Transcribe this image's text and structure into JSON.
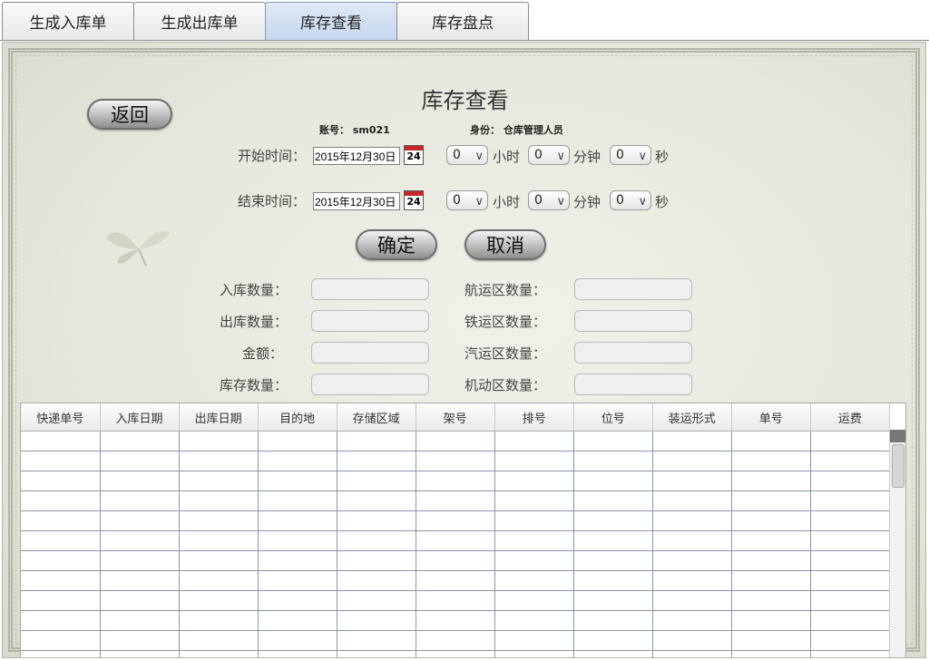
{
  "tabs": [
    {
      "label": "生成入库单",
      "active": false
    },
    {
      "label": "生成出库单",
      "active": false
    },
    {
      "label": "库存查看",
      "active": true
    },
    {
      "label": "库存盘点",
      "active": false
    }
  ],
  "back_label": "返回",
  "page_title": "库存查看",
  "account": "账号： sm021",
  "role": "身份： 仓库管理人员",
  "start": {
    "label": "开始时间：",
    "date": "2015年12月30日",
    "calendar_day": "24",
    "hour": "0",
    "minute": "0",
    "second": "0"
  },
  "end": {
    "label": "结束时间：",
    "date": "2015年12月30日",
    "calendar_day": "24",
    "hour": "0",
    "minute": "0",
    "second": "0"
  },
  "units": {
    "hour": "小时",
    "minute": "分钟",
    "second": "秒"
  },
  "buttons": {
    "confirm": "确定",
    "cancel": "取消"
  },
  "stats": {
    "in_count": "入库数量：",
    "out_count": "出库数量：",
    "amount": "金额：",
    "stock_count": "库存数量：",
    "ship_zone": "航运区数量：",
    "rail_zone": "铁运区数量：",
    "truck_zone": "汽运区数量：",
    "flex_zone": "机动区数量："
  },
  "table": {
    "columns": [
      "快递单号",
      "入库日期",
      "出库日期",
      "目的地",
      "存储区域",
      "架号",
      "排号",
      "位号",
      "装运形式",
      "单号",
      "运费"
    ]
  },
  "colors": {
    "active_tab": "#c6d7ee",
    "calendar_header": "#c62828"
  }
}
